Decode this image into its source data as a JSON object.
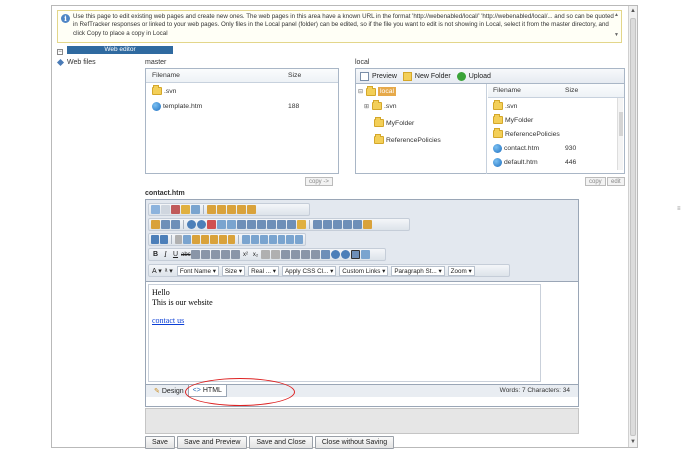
{
  "info": {
    "text": "Use this page to edit existing web pages and create new ones. The web pages in this area have a known URL in the format 'http://webenabled/local/' 'http://webenabled/local/... and so can be quoted in RefTracker responses or linked to your web pages. Only files in the Local panel (folder) can be edited, so if the file you want to edit is not showing in Local, select it from the master directory, and click Copy to place a copy in Local"
  },
  "section": {
    "title": "Web editor",
    "toggle": "⊟"
  },
  "tree": {
    "item": "Web files"
  },
  "master": {
    "label": "master",
    "columns": [
      "Filename",
      "Size"
    ],
    "rows": [
      {
        "name": ".svn",
        "size": "",
        "type": "folder"
      },
      {
        "name": "template.htm",
        "size": "188",
        "type": "file"
      }
    ],
    "copy_button": "copy ->"
  },
  "local": {
    "label": "local",
    "toolbar": {
      "preview": "Preview",
      "new_folder": "New Folder",
      "upload": "Upload"
    },
    "tree": {
      "root": "local",
      "children": [
        ".svn",
        "MyFolder",
        "ReferencePolicies"
      ]
    },
    "columns": [
      "Filename",
      "Size"
    ],
    "rows": [
      {
        "name": ".svn",
        "size": "",
        "type": "folder"
      },
      {
        "name": "MyFolder",
        "size": "",
        "type": "folder"
      },
      {
        "name": "ReferencePolicies",
        "size": "",
        "type": "folder"
      },
      {
        "name": "contact.htm",
        "size": "930",
        "type": "file"
      },
      {
        "name": "default.htm",
        "size": "446",
        "type": "file"
      }
    ],
    "copy_button": "copy",
    "edit_button": "edit"
  },
  "editor": {
    "filename": "contact.htm",
    "dropdowns": [
      "Font Name",
      "Size",
      "Real ...",
      "Apply CSS Cl...",
      "Custom Links",
      "Paragraph St...",
      "Zoom"
    ],
    "content": {
      "line1": "Hello",
      "line2": "This is our website",
      "link": "contact us"
    },
    "modes": {
      "design": "Design",
      "html": "HTML"
    },
    "wordcount": "Words: 7  Characters: 34"
  },
  "buttons": {
    "save": "Save",
    "save_preview": "Save and Preview",
    "save_close": "Save and Close",
    "close_nosave": "Close without Saving"
  },
  "colors": {
    "section_header": "#2f6aa0",
    "highlight": "#dd2222",
    "link": "#0b3fd6"
  }
}
